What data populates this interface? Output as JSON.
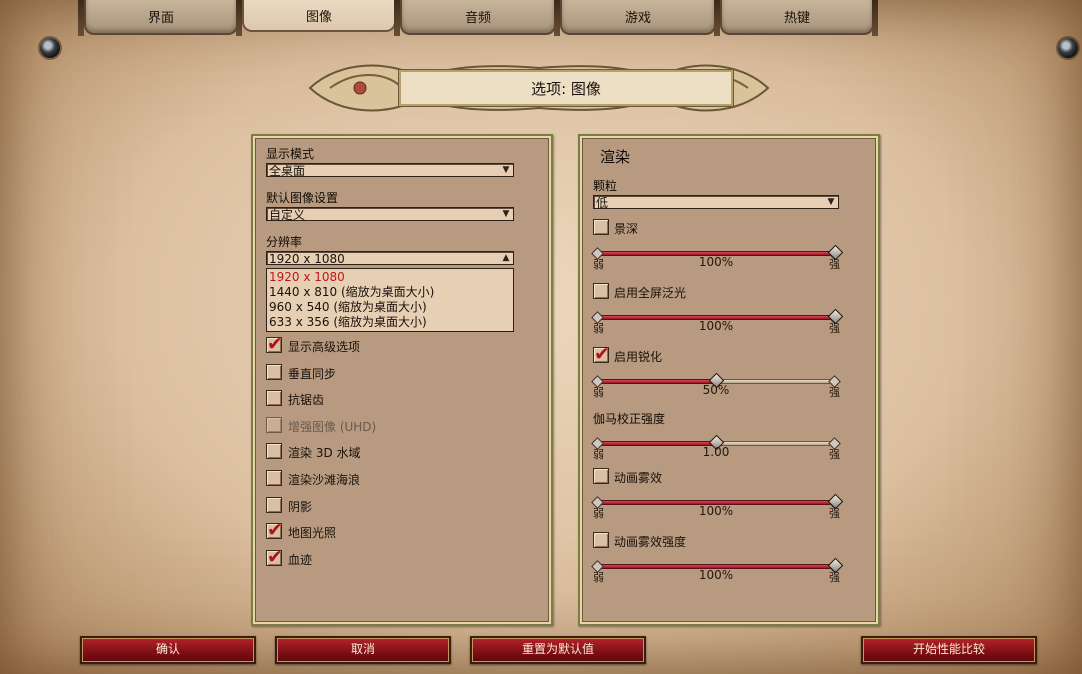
{
  "tabs": [
    {
      "label": "界面",
      "active": false
    },
    {
      "label": "图像",
      "active": true
    },
    {
      "label": "音频",
      "active": false
    },
    {
      "label": "游戏",
      "active": false
    },
    {
      "label": "热键",
      "active": false
    }
  ],
  "title": "选项: 图像",
  "left_panel": {
    "display_mode": {
      "label": "显示模式",
      "value": "全桌面"
    },
    "default_preset": {
      "label": "默认图像设置",
      "value": "自定义"
    },
    "resolution": {
      "label": "分辨率",
      "value": "1920 x 1080",
      "options": [
        "1920 x 1080",
        "1440 x 810 (缩放为桌面大小)",
        "960 x 540 (缩放为桌面大小)",
        "633 x 356 (缩放为桌面大小)"
      ],
      "selected_index": 0
    },
    "checkboxes": [
      {
        "label": "显示高级选项",
        "checked": true,
        "enabled": true
      },
      {
        "label": "垂直同步",
        "checked": false,
        "enabled": true
      },
      {
        "label": "抗锯齿",
        "checked": false,
        "enabled": true
      },
      {
        "label": "增强图像 (UHD)",
        "checked": false,
        "enabled": false
      },
      {
        "label": "渲染 3D 水域",
        "checked": false,
        "enabled": true
      },
      {
        "label": "渲染沙滩海浪",
        "checked": false,
        "enabled": true
      },
      {
        "label": "阴影",
        "checked": false,
        "enabled": true
      },
      {
        "label": "地图光照",
        "checked": true,
        "enabled": true
      },
      {
        "label": "血迹",
        "checked": true,
        "enabled": true
      }
    ]
  },
  "right_panel": {
    "heading": "渲染",
    "particles": {
      "label": "颗粒",
      "value": "低"
    },
    "weak_label": "弱",
    "strong_label": "强",
    "settings": [
      {
        "type": "check",
        "label": "景深",
        "checked": false,
        "slider_fraction": 1.0,
        "value_text": "100%"
      },
      {
        "type": "check",
        "label": "启用全屏泛光",
        "checked": false,
        "slider_fraction": 1.0,
        "value_text": "100%"
      },
      {
        "type": "check",
        "label": "启用锐化",
        "checked": true,
        "slider_fraction": 0.5,
        "value_text": "50%"
      },
      {
        "type": "label",
        "label": "伽马校正强度",
        "slider_fraction": 0.5,
        "value_text": "1.00"
      },
      {
        "type": "check",
        "label": "动画雾效",
        "checked": false,
        "slider_fraction": 1.0,
        "value_text": "100%"
      },
      {
        "type": "check",
        "label": "动画雾效强度",
        "checked": false,
        "slider_fraction": 1.0,
        "value_text": "100%"
      }
    ]
  },
  "buttons": {
    "confirm": "确认",
    "cancel": "取消",
    "reset": "重置为默认值",
    "benchmark": "开始性能比较"
  },
  "colors": {
    "accent_red": "#b1121a",
    "panel": "#b79a80",
    "parchment": "#e2c8a8"
  }
}
